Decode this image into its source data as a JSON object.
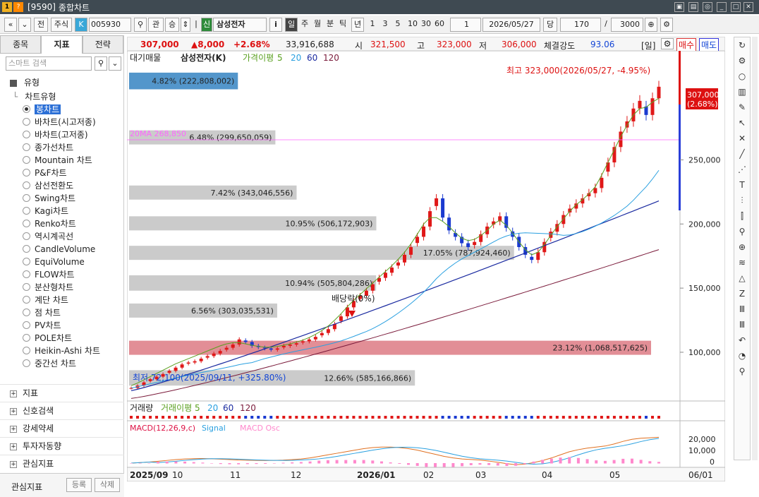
{
  "window": {
    "code": "[9590]",
    "title": "종합차트"
  },
  "toolbar": {
    "market": "전",
    "type": "주식",
    "k_label": "K",
    "code": "005930",
    "gwan": "관",
    "seung": "승",
    "sin": "신",
    "stock_name": "삼성전자",
    "info": "i",
    "periods": [
      "일",
      "주",
      "월",
      "분",
      "틱",
      "년"
    ],
    "active_period": "일",
    "intervals": [
      "1",
      "3",
      "5",
      "10",
      "30",
      "60"
    ],
    "count_small": "1",
    "date": "2026/05/27",
    "dang": "당",
    "view_count": "170",
    "slash": "/",
    "total_count": "3000"
  },
  "sidebar": {
    "tabs": [
      "종목",
      "지표",
      "전략"
    ],
    "active_tab": "지표",
    "search_placeholder": "스마트 검색",
    "group_label": "유형",
    "tree_parent": "차트유형",
    "chart_types": [
      "봉차트",
      "바차트(시고저종)",
      "바차트(고저종)",
      "종가선차트",
      "Mountain 차트",
      "P&F차트",
      "삼선전환도",
      "Swing차트",
      "Kagi차트",
      "Renko차트",
      "역시계곡선",
      "CandleVolume",
      "EquiVolume",
      "FLOW차트",
      "분산형차트",
      "계단 차트",
      "점 차트",
      "PV차트",
      "POLE차트",
      "Heikin-Ashi 차트",
      "중간선 차트"
    ],
    "selected_type": "봉차트",
    "sections": [
      "지표",
      "신호검색",
      "강세약세",
      "투자자동향",
      "관심지표"
    ],
    "footer_label": "관심지표",
    "register_button": "등록",
    "delete_button": "삭제"
  },
  "infobar": {
    "price": "307,000",
    "change": "▲8,000",
    "change_pct": "+2.68%",
    "volume": "33,916,688",
    "open_label": "시",
    "open": "321,500",
    "high_label": "고",
    "high": "323,000",
    "low_label": "저",
    "low": "306,000",
    "strength_label": "체결강도",
    "strength": "93.06",
    "period_tag": "[일]",
    "buy_button": "매수",
    "sell_button": "매도"
  },
  "legend": {
    "overlay": "대기매물",
    "stock": "삼성전자(K)",
    "ma_label": "가격이평",
    "ma_periods": [
      "5",
      "20",
      "60",
      "120"
    ]
  },
  "annotations": {
    "high_note": "최고 323,000(2026/05/27, -4.95%)",
    "low_note": "최저 72,100(2025/09/11, +325.80%)",
    "dividend": "배당락(0%)",
    "ma20_tag": "20MA 268,850",
    "last_price": "307,000",
    "last_pct": "(2.68%)"
  },
  "volume_panel": {
    "title": "거래량",
    "ma_label": "거래이평",
    "ma_periods": [
      "5",
      "20",
      "60",
      "120"
    ]
  },
  "macd_panel": {
    "title": "MACD(12,26,9,c)",
    "signal": "Signal",
    "osc": "MACD Osc",
    "ticks": [
      "20,000",
      "10,000",
      "0"
    ]
  },
  "x_axis": [
    "2025/09",
    "10",
    "11",
    "12",
    "2026/01",
    "02",
    "03",
    "04",
    "05",
    "06/01"
  ],
  "y_axis": [
    "250,000",
    "200,000",
    "150,000",
    "100,000"
  ],
  "chart_data": {
    "type": "candlestick",
    "title": "삼성전자(K)",
    "ylim": [
      62000,
      335000
    ],
    "volume_profile": [
      {
        "pct": "4.82%",
        "vol": "222,808,002",
        "low": 305000,
        "high": 318000
      },
      {
        "pct": "6.48%",
        "vol": "299,650,059",
        "low": 262000,
        "high": 273000
      },
      {
        "pct": "7.42%",
        "vol": "343,046,556",
        "low": 219000,
        "high": 230000
      },
      {
        "pct": "10.95%",
        "vol": "506,172,903",
        "low": 195000,
        "high": 206000
      },
      {
        "pct": "17.05%",
        "vol": "787,924,460",
        "low": 172000,
        "high": 183000
      },
      {
        "pct": "10.94%",
        "vol": "505,804,286",
        "low": 148000,
        "high": 160000
      },
      {
        "pct": "6.56%",
        "vol": "303,035,531",
        "low": 127000,
        "high": 138000
      },
      {
        "pct": "23.12%",
        "vol": "1,068,517,625",
        "low": 98000,
        "high": 109000
      },
      {
        "pct": "12.66%",
        "vol": "585,166,866",
        "low": 74000,
        "high": 86000
      }
    ],
    "close": [
      72100,
      74000,
      76500,
      79000,
      81000,
      83000,
      85500,
      88000,
      90500,
      92000,
      93000,
      95000,
      97000,
      99000,
      101000,
      103500,
      106000,
      110000,
      108000,
      105000,
      104000,
      103000,
      102000,
      103000,
      105000,
      106000,
      107000,
      108500,
      110000,
      112000,
      115000,
      118000,
      122000,
      128000,
      135000,
      140000,
      144000,
      148000,
      153000,
      158000,
      162000,
      166000,
      170000,
      176000,
      182000,
      190000,
      198000,
      210000,
      220000,
      205000,
      195000,
      190000,
      185000,
      182000,
      186000,
      192000,
      198000,
      202000,
      206000,
      197000,
      190000,
      182000,
      176000,
      172000,
      178000,
      186000,
      194000,
      200000,
      207000,
      212000,
      216000,
      220000,
      224000,
      228000,
      236000,
      248000,
      260000,
      272000,
      280000,
      290000,
      296000,
      285000,
      298000,
      307000
    ],
    "ma5": [
      74000,
      76000,
      78500,
      81000,
      83500,
      86000,
      88500,
      91000,
      93000,
      95000,
      97000,
      99000,
      101000,
      103000,
      105000,
      106500,
      107500,
      107500,
      106500,
      105500,
      104500,
      104000,
      104000,
      104500,
      105500,
      106500,
      108000,
      109500,
      111500,
      114000,
      117000,
      120500,
      125000,
      130000,
      135500,
      140500,
      145000,
      149500,
      154000,
      158500,
      163000,
      167500,
      172500,
      178000,
      184500,
      192000,
      200000,
      205000,
      205000,
      202000,
      198000,
      193000,
      189000,
      187000,
      188000,
      191000,
      195000,
      200000,
      203000,
      199000,
      193000,
      186000,
      180000,
      176000,
      178000,
      184000,
      191000,
      198000,
      204000,
      210000,
      215000,
      219000,
      223500,
      229000,
      238000,
      248000,
      258000,
      268000,
      277000,
      285000,
      290000,
      291000,
      295000,
      298000
    ],
    "ma20_last": 268850,
    "ma60_last": 218000,
    "ma120_last": 180000,
    "macd": [
      0,
      500,
      1000,
      1800,
      2600,
      3400,
      4000,
      4300,
      4400,
      4200,
      3800,
      3400,
      3000,
      2800,
      2600,
      2500,
      2600,
      2900,
      3400,
      4000,
      5000,
      6500,
      8000,
      9500,
      11000,
      12500,
      14000,
      15000,
      15500,
      15500,
      15000,
      14000,
      12500,
      10500,
      8500,
      6500,
      5000,
      4000,
      3500,
      3000,
      2000,
      800,
      -500,
      -1500,
      -1000,
      500,
      2500,
      5000,
      8000,
      11000,
      13000,
      14500,
      15500,
      16500,
      18500,
      21000,
      23000,
      24000,
      24500,
      25000
    ]
  }
}
